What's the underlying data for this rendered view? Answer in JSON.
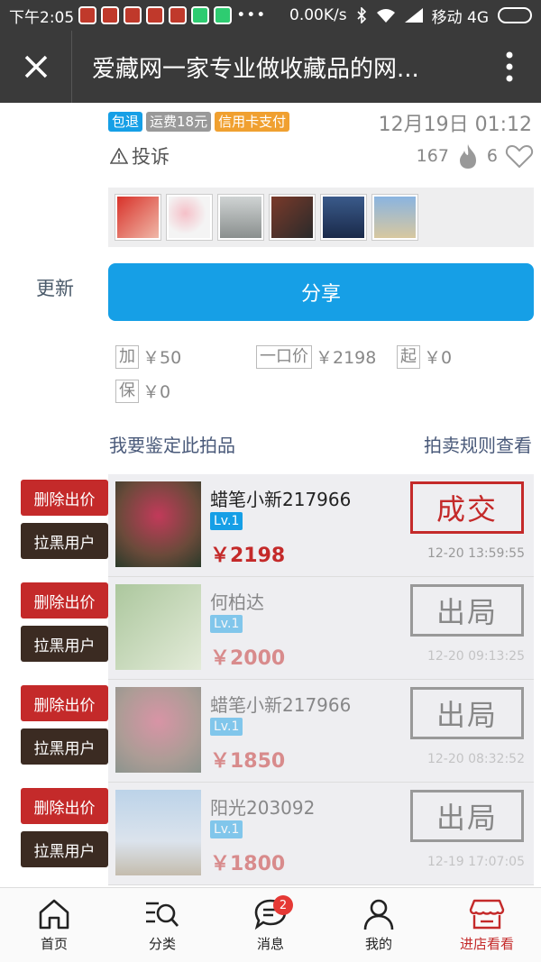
{
  "status_bar": {
    "time": "下午2:05",
    "network_speed": "0.00K/s",
    "carrier": "移动 4G"
  },
  "titlebar": {
    "title": "爱藏网一家专业做收藏品的网..."
  },
  "item": {
    "tags": [
      {
        "label": "包退",
        "color": "#169fe6"
      },
      {
        "label": "运费18元",
        "color": "#999999"
      },
      {
        "label": "信用卡支付",
        "color": "#f0a030"
      }
    ],
    "date": "12月19日 01:12",
    "complain_label": "投诉",
    "view_count": "167",
    "like_count": "6"
  },
  "actions": {
    "update_label": "更新",
    "share_label": "分享"
  },
  "params": [
    {
      "key": "加",
      "value": "￥50"
    },
    {
      "key": "一口价",
      "value": "￥2198"
    },
    {
      "key": "起",
      "value": "￥0"
    },
    {
      "key": "保",
      "value": "￥0"
    }
  ],
  "links": {
    "appraise": "我要鉴定此拍品",
    "rules": "拍卖规则查看"
  },
  "bid_actions": {
    "delete_label": "删除出价",
    "block_label": "拉黑用户"
  },
  "bids": [
    {
      "name": "蜡笔小新217966",
      "level": "Lv.1",
      "price": "￥2198",
      "status": "成交",
      "time": "12-20 13:59:55"
    },
    {
      "name": "何柏达",
      "level": "Lv.1",
      "price": "￥2000",
      "status": "出局",
      "time": "12-20 09:13:25"
    },
    {
      "name": "蜡笔小新217966",
      "level": "Lv.1",
      "price": "￥1850",
      "status": "出局",
      "time": "12-20 08:32:52"
    },
    {
      "name": "阳光203092",
      "level": "Lv.1",
      "price": "￥1800",
      "status": "出局",
      "time": "12-19 17:07:05"
    }
  ],
  "nav": {
    "items": [
      {
        "label": "首页",
        "icon": "home-icon"
      },
      {
        "label": "分类",
        "icon": "category-search-icon"
      },
      {
        "label": "消息",
        "icon": "message-icon",
        "badge": "2"
      },
      {
        "label": "我的",
        "icon": "user-icon"
      },
      {
        "label": "进店看看",
        "icon": "store-icon"
      }
    ]
  },
  "colors": {
    "accent": "#169fe6",
    "danger": "#c42a2a",
    "dark_bar": "#3a3a3a"
  }
}
